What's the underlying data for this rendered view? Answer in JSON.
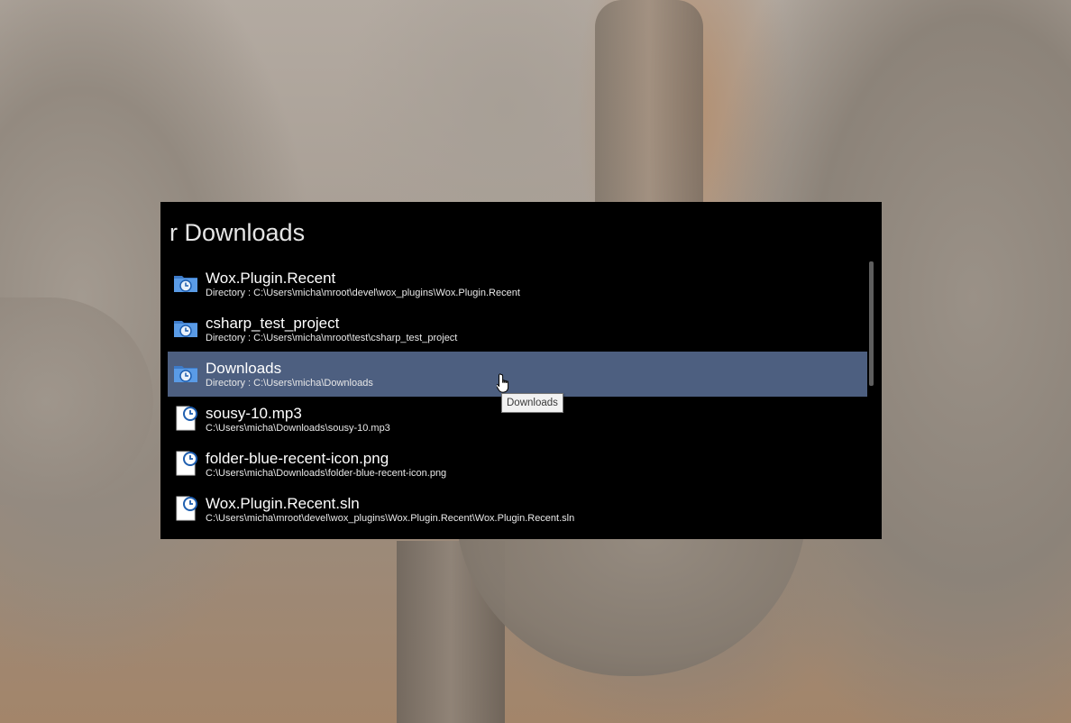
{
  "launcher": {
    "query": "r Downloads",
    "selected_index": 2,
    "results": [
      {
        "icon": "folder-recent-icon",
        "title": "Wox.Plugin.Recent",
        "subtitle": "Directory : C:\\Users\\micha\\mroot\\devel\\wox_plugins\\Wox.Plugin.Recent"
      },
      {
        "icon": "folder-recent-icon",
        "title": "csharp_test_project",
        "subtitle": "Directory : C:\\Users\\micha\\mroot\\test\\csharp_test_project"
      },
      {
        "icon": "folder-recent-icon",
        "title": "Downloads",
        "subtitle": "Directory : C:\\Users\\micha\\Downloads"
      },
      {
        "icon": "file-recent-icon",
        "title": "sousy-10.mp3",
        "subtitle": "C:\\Users\\micha\\Downloads\\sousy-10.mp3"
      },
      {
        "icon": "file-recent-icon",
        "title": "folder-blue-recent-icon.png",
        "subtitle": "C:\\Users\\micha\\Downloads\\folder-blue-recent-icon.png"
      },
      {
        "icon": "file-recent-icon",
        "title": "Wox.Plugin.Recent.sln",
        "subtitle": "C:\\Users\\micha\\mroot\\devel\\wox_plugins\\Wox.Plugin.Recent\\Wox.Plugin.Recent.sln"
      }
    ]
  },
  "tooltip": {
    "text": "Downloads"
  },
  "colors": {
    "window_bg": "#000000",
    "selection_bg": "#4d5f80",
    "folder_blue": "#4a8ad8",
    "clock_blue": "#1f5fb0"
  }
}
